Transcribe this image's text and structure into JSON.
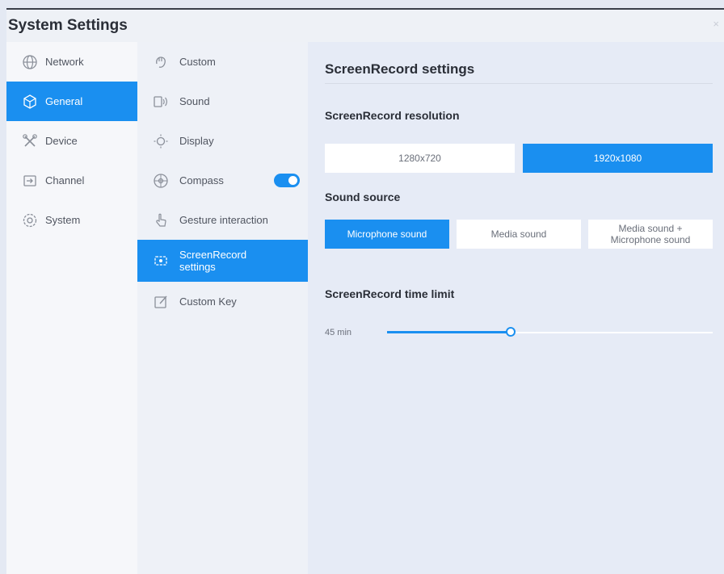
{
  "window": {
    "title": "System Settings",
    "close_glyph": "×"
  },
  "sidebar": {
    "items": [
      {
        "label": "Network",
        "icon": "globe-icon",
        "active": false
      },
      {
        "label": "General",
        "icon": "cube-icon",
        "active": true
      },
      {
        "label": "Device",
        "icon": "tools-icon",
        "active": false
      },
      {
        "label": "Channel",
        "icon": "input-icon",
        "active": false
      },
      {
        "label": "System",
        "icon": "gear-icon",
        "active": false
      }
    ]
  },
  "subnav": {
    "items": [
      {
        "label": "Custom",
        "icon": "hand-icon",
        "active": false
      },
      {
        "label": "Sound",
        "icon": "speaker-icon",
        "active": false
      },
      {
        "label": "Display",
        "icon": "sun-icon",
        "active": false
      },
      {
        "label": "Compass",
        "icon": "compass-icon",
        "active": false,
        "toggle_on": true
      },
      {
        "label": "Gesture interaction",
        "icon": "pointer-icon",
        "active": false
      },
      {
        "label": "ScreenRecord settings",
        "icon": "record-icon",
        "active": true
      },
      {
        "label": "Custom Key",
        "icon": "edit-icon",
        "active": false
      }
    ]
  },
  "content": {
    "title": "ScreenRecord settings",
    "resolution": {
      "heading": "ScreenRecord resolution",
      "options": [
        "1280x720",
        "1920x1080"
      ],
      "selected": "1920x1080"
    },
    "sound": {
      "heading": "Sound source",
      "options": [
        "Microphone sound",
        "Media sound",
        "Media sound + Microphone sound"
      ],
      "selected": "Microphone sound"
    },
    "time_limit": {
      "heading": "ScreenRecord time limit",
      "value_label": "45 min",
      "fraction": 0.38
    }
  },
  "colors": {
    "accent": "#1a8ff0",
    "sidebar_bg": "#f6f7fa",
    "content_bg": "#e6ebf6"
  }
}
